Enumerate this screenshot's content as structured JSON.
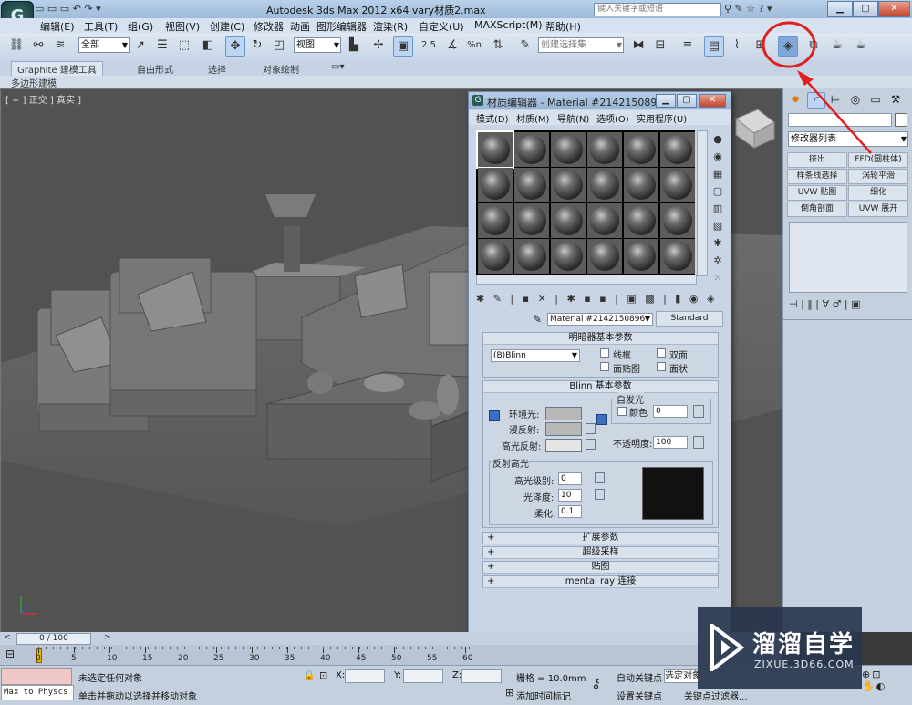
{
  "app": {
    "title": "Autodesk 3ds Max  2012 x64      vary材质2.max",
    "search_placeholder": "键入关键字或短语"
  },
  "menubar": [
    "编辑(E)",
    "工具(T)",
    "组(G)",
    "视图(V)",
    "创建(C)",
    "修改器",
    "动画",
    "图形编辑器",
    "渲染(R)",
    "自定义(U)",
    "MAXScript(M)",
    "帮助(H)"
  ],
  "toolbar": {
    "selection_filter": "全部",
    "reference_coord": "视图",
    "named_selection": "创建选择集",
    "snap_values": [
      "2.5",
      "%n"
    ]
  },
  "ribbon": {
    "tabs": [
      "Graphite 建模工具",
      "自由形式",
      "选择",
      "对象绘制"
    ],
    "sub": "多边形建模"
  },
  "viewport": {
    "label": "[ + ] 正交 ] 真实 ]"
  },
  "material_editor": {
    "title": "材质编辑器 - Material #2142150896",
    "menu": [
      "模式(D)",
      "材质(M)",
      "导航(N)",
      "选项(O)",
      "实用程序(U)"
    ],
    "material_name": "Material #2142150896",
    "material_type": "Standard",
    "shader_rollout": {
      "title": "明暗器基本参数",
      "shader": "(B)Blinn",
      "options": [
        "线框",
        "双面",
        "面贴图",
        "面状"
      ]
    },
    "blinn_rollout": {
      "title": "Blinn 基本参数",
      "self_illum": "自发光",
      "color_label": "颜色",
      "color_value": "0",
      "ambient": "环境光:",
      "diffuse": "漫反射:",
      "specular": "高光反射:",
      "opacity_label": "不透明度:",
      "opacity_value": "100",
      "spec_group": "反射高光",
      "spec_level_label": "高光级别:",
      "spec_level": "0",
      "gloss_label": "光泽度:",
      "gloss": "10",
      "soften_label": "柔化:",
      "soften": "0.1"
    },
    "collapsed_rollouts": [
      "扩展参数",
      "超级采样",
      "贴图",
      "mental ray 连接"
    ],
    "slot_count": 24
  },
  "command_panel": {
    "modifier_list": "修改器列表",
    "buttons": [
      "挤出",
      "FFD(圆柱体)",
      "样条线选择",
      "涡轮平滑",
      "UVW 贴图",
      "细化",
      "倒角剖面",
      "UVW 展开"
    ]
  },
  "timeline": {
    "frame": "0 / 100",
    "ticks": [
      "0",
      "5",
      "10",
      "15",
      "20",
      "25",
      "30",
      "35",
      "40",
      "45",
      "50",
      "55",
      "60"
    ]
  },
  "status": {
    "script": "Max to Physcs (",
    "selection": "未选定任何对象",
    "prompt": "单击并拖动以选择并移动对象",
    "x_label": "X:",
    "y_label": "Y:",
    "z_label": "Z:",
    "grid": "栅格 = 10.0mm",
    "add_time_tag": "添加时间标记",
    "auto_key": "自动关键点",
    "selected": "选定对象",
    "set_key": "设置关键点",
    "key_filters": "关键点过滤器..."
  },
  "watermark": {
    "brand": "溜溜自学",
    "url": "ZIXUE.3D66.COM"
  },
  "colors": {
    "annotation_red": "#e02020",
    "viewport_bg": "#525252",
    "ui_blue": "#c5d0de"
  }
}
